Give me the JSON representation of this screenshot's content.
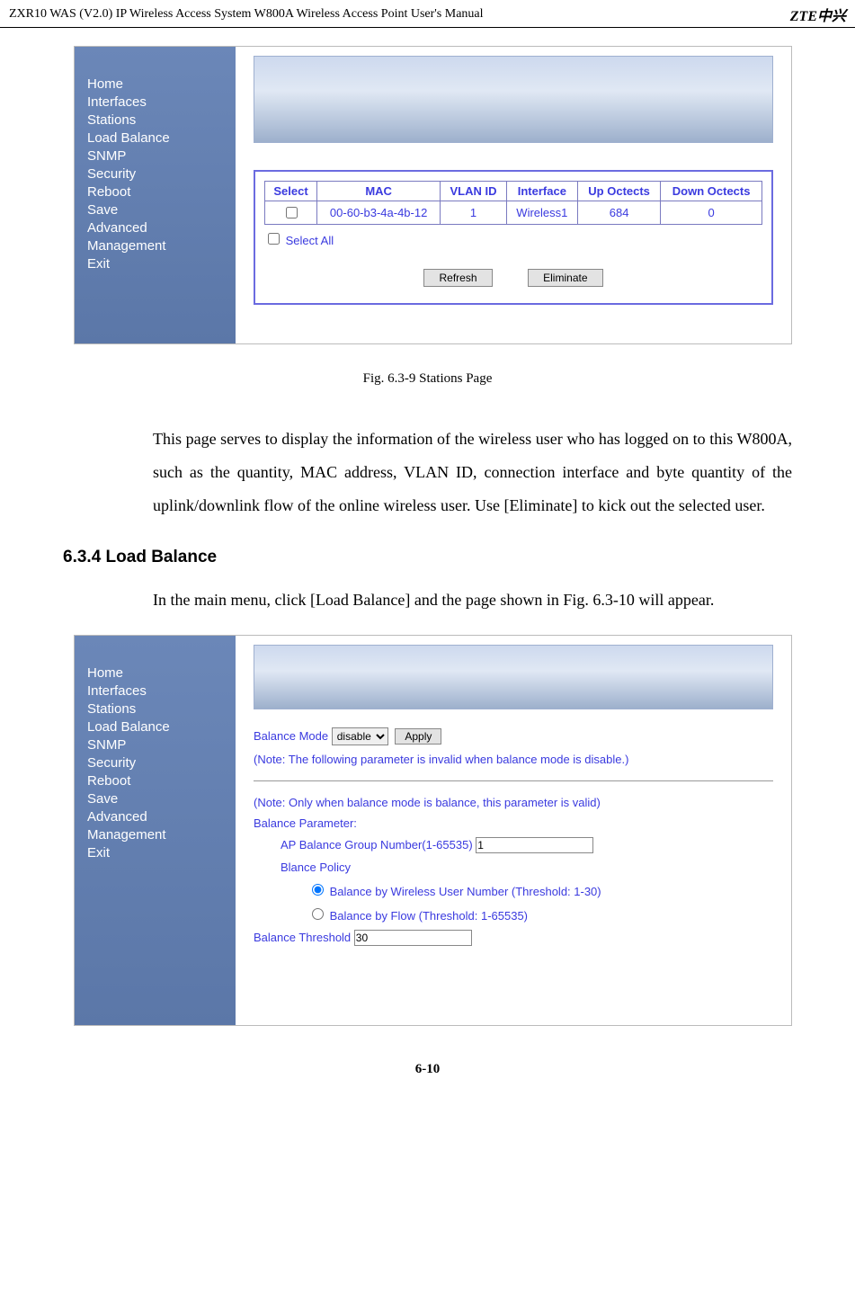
{
  "header": {
    "doc_title": "ZXR10 WAS (V2.0) IP Wireless Access System W800A Wireless Access Point User's Manual",
    "logo_text": "ZTE中兴"
  },
  "sidebar": {
    "items": [
      "Home",
      "Interfaces",
      "Stations",
      "Load Balance",
      "SNMP",
      "Security",
      "Reboot",
      "Save",
      "Advanced",
      "Management",
      "Exit"
    ]
  },
  "stations": {
    "table": {
      "headers": [
        "Select",
        "MAC",
        "VLAN ID",
        "Interface",
        "Up Octects",
        "Down Octects"
      ],
      "row": {
        "mac": "00-60-b3-4a-4b-12",
        "vlan": "1",
        "iface": "Wireless1",
        "up": "684",
        "down": "0"
      }
    },
    "select_all": "Select All",
    "btn_refresh": "Refresh",
    "btn_eliminate": "Eliminate"
  },
  "caption1": "Fig. 6.3-9    Stations Page",
  "para1": "This page serves to display the information of the wireless user who has logged on to this W800A, such as the quantity, MAC address, VLAN ID, connection interface and byte quantity of the uplink/downlink flow of the online wireless user. Use [Eliminate] to kick out the selected user.",
  "section_heading": "6.3.4 Load Balance",
  "para2": "In the main menu, click [Load Balance] and the page shown in Fig. 6.3-10 will appear.",
  "loadbalance": {
    "mode_label": "Balance Mode",
    "mode_value": "disable",
    "apply": "Apply",
    "note1": "(Note: The following parameter is invalid when balance mode is disable.)",
    "note2": "(Note: Only when balance mode is balance, this parameter is valid)",
    "param_heading": "Balance Parameter:",
    "group_label": "AP Balance Group Number(1-65535)",
    "group_value": "1",
    "policy_heading": "Blance Policy",
    "policy1": "Balance by Wireless User Number (Threshold: 1-30)",
    "policy2": "Balance by Flow (Threshold: 1-65535)",
    "threshold_label": "Balance Threshold",
    "threshold_value": "30"
  },
  "page_number": "6-10"
}
